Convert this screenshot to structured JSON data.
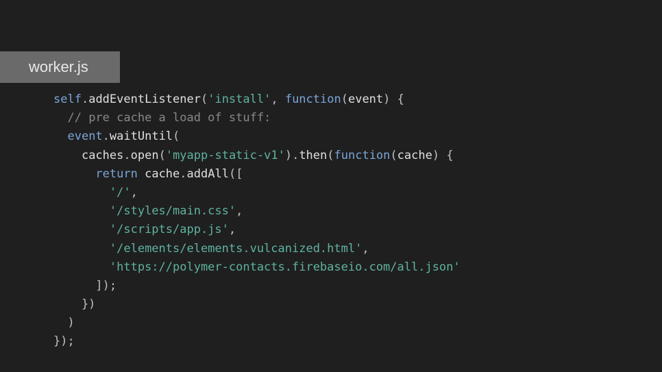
{
  "tab": {
    "label": "worker.js"
  },
  "code": {
    "tokens": [
      [
        {
          "t": "self",
          "c": "c-variable"
        },
        {
          "t": ".",
          "c": "c-punct"
        },
        {
          "t": "addEventListener",
          "c": "c-default"
        },
        {
          "t": "(",
          "c": "c-punct"
        },
        {
          "t": "'install'",
          "c": "c-string"
        },
        {
          "t": ", ",
          "c": "c-punct"
        },
        {
          "t": "function",
          "c": "c-keyword"
        },
        {
          "t": "(",
          "c": "c-punct"
        },
        {
          "t": "event",
          "c": "c-default"
        },
        {
          "t": ") {",
          "c": "c-punct"
        }
      ],
      [
        {
          "t": "  ",
          "c": "c-default"
        },
        {
          "t": "// pre cache a load of stuff:",
          "c": "c-comment"
        }
      ],
      [
        {
          "t": "  ",
          "c": "c-default"
        },
        {
          "t": "event",
          "c": "c-variable"
        },
        {
          "t": ".",
          "c": "c-punct"
        },
        {
          "t": "waitUntil",
          "c": "c-default"
        },
        {
          "t": "(",
          "c": "c-punct"
        }
      ],
      [
        {
          "t": "    ",
          "c": "c-default"
        },
        {
          "t": "caches",
          "c": "c-default"
        },
        {
          "t": ".",
          "c": "c-punct"
        },
        {
          "t": "open",
          "c": "c-default"
        },
        {
          "t": "(",
          "c": "c-punct"
        },
        {
          "t": "'myapp-static-v1'",
          "c": "c-string"
        },
        {
          "t": ").",
          "c": "c-punct"
        },
        {
          "t": "then",
          "c": "c-default"
        },
        {
          "t": "(",
          "c": "c-punct"
        },
        {
          "t": "function",
          "c": "c-keyword"
        },
        {
          "t": "(",
          "c": "c-punct"
        },
        {
          "t": "cache",
          "c": "c-default"
        },
        {
          "t": ") {",
          "c": "c-punct"
        }
      ],
      [
        {
          "t": "      ",
          "c": "c-default"
        },
        {
          "t": "return",
          "c": "c-keyword"
        },
        {
          "t": " ",
          "c": "c-default"
        },
        {
          "t": "cache",
          "c": "c-default"
        },
        {
          "t": ".",
          "c": "c-punct"
        },
        {
          "t": "addAll",
          "c": "c-default"
        },
        {
          "t": "([",
          "c": "c-punct"
        }
      ],
      [
        {
          "t": "        ",
          "c": "c-default"
        },
        {
          "t": "'/'",
          "c": "c-string"
        },
        {
          "t": ",",
          "c": "c-punct"
        }
      ],
      [
        {
          "t": "        ",
          "c": "c-default"
        },
        {
          "t": "'/styles/main.css'",
          "c": "c-string"
        },
        {
          "t": ",",
          "c": "c-punct"
        }
      ],
      [
        {
          "t": "        ",
          "c": "c-default"
        },
        {
          "t": "'/scripts/app.js'",
          "c": "c-string"
        },
        {
          "t": ",",
          "c": "c-punct"
        }
      ],
      [
        {
          "t": "        ",
          "c": "c-default"
        },
        {
          "t": "'/elements/elements.vulcanized.html'",
          "c": "c-string"
        },
        {
          "t": ",",
          "c": "c-punct"
        }
      ],
      [
        {
          "t": "        ",
          "c": "c-default"
        },
        {
          "t": "'https://polymer-contacts.firebaseio.com/all.json'",
          "c": "c-string"
        }
      ],
      [
        {
          "t": "      ]);",
          "c": "c-punct"
        }
      ],
      [
        {
          "t": "    })",
          "c": "c-punct"
        }
      ],
      [
        {
          "t": "  )",
          "c": "c-punct"
        }
      ],
      [
        {
          "t": "});",
          "c": "c-punct"
        }
      ]
    ]
  }
}
